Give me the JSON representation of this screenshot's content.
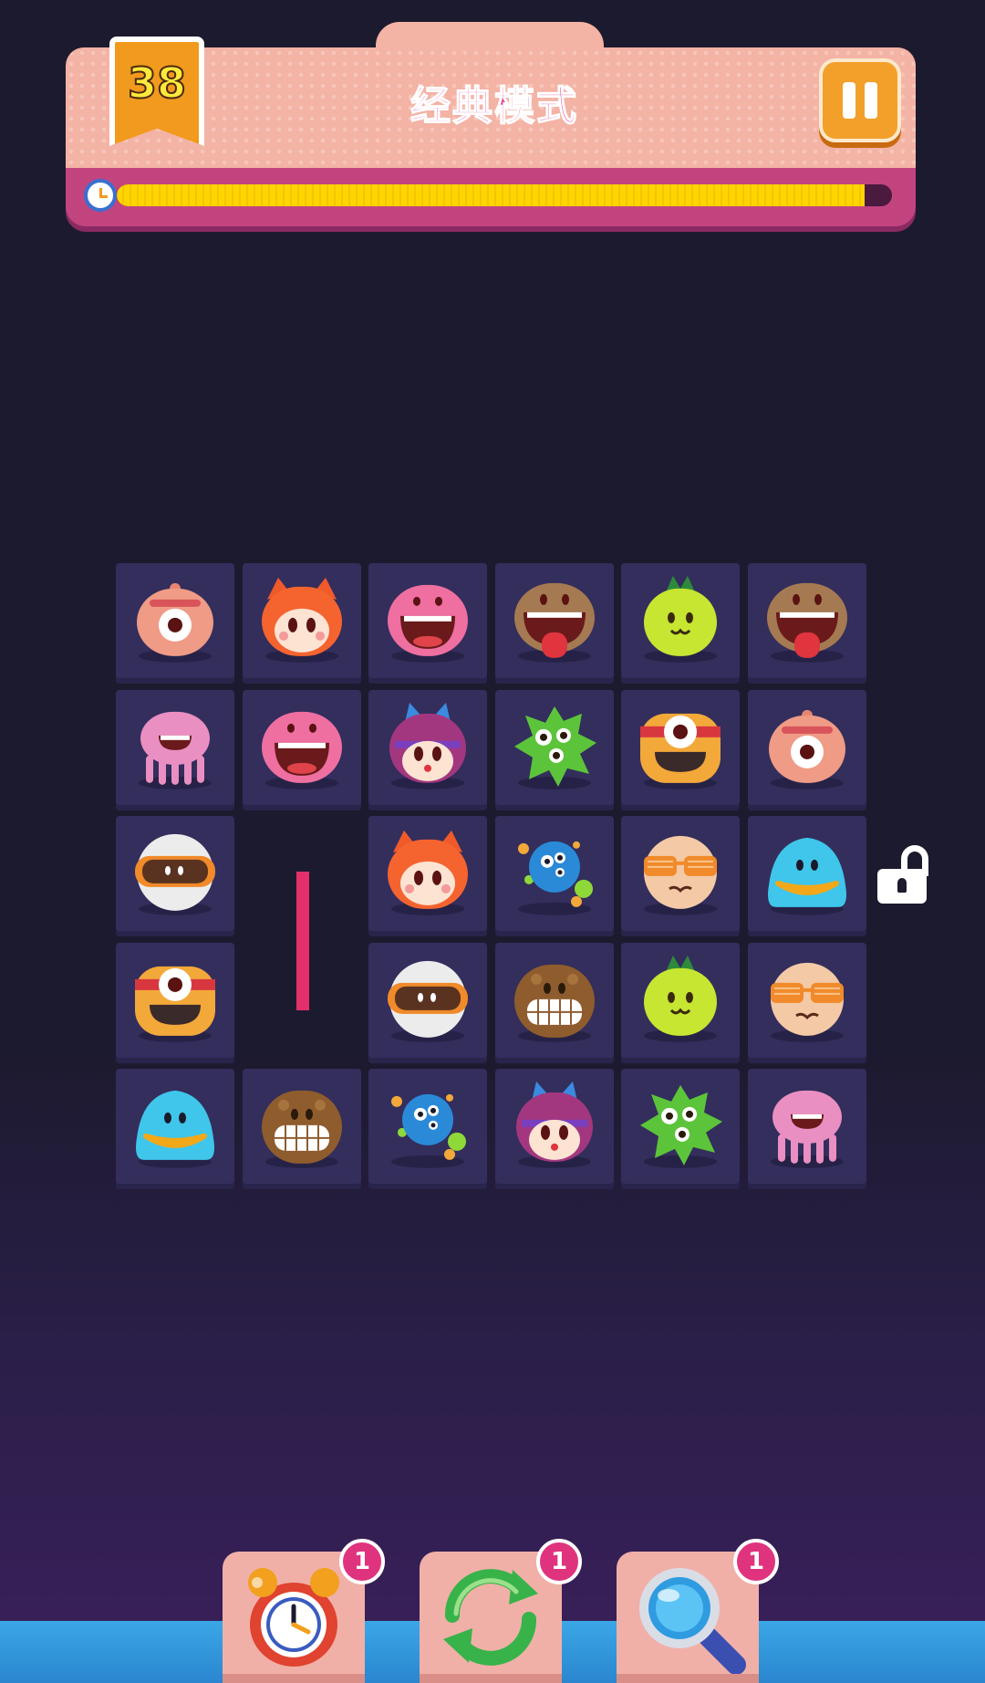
{
  "header": {
    "level": "38",
    "mode_title": "经典模式"
  },
  "timer": {
    "progress": 0.965,
    "icon": "clock-icon"
  },
  "board": {
    "columns": 6,
    "rows": 5,
    "tiles": [
      [
        "pink-cyclops",
        "orange-fox",
        "pink-screamer",
        "brown-tongue",
        "lime-sprout",
        "brown-tongue"
      ],
      [
        "pink-jellyfish",
        "pink-screamer",
        "purple-hood",
        "green-splat",
        "orange-cyclops",
        "pink-cyclops"
      ],
      [
        "helmet-visor",
        "",
        "orange-fox",
        "blue-bubbles",
        "peach-shades",
        "cyan-smile"
      ],
      [
        "orange-cyclops",
        "",
        "helmet-visor",
        "brown-grin",
        "lime-sprout",
        "peach-shades"
      ],
      [
        "cyan-smile",
        "brown-grin",
        "blue-bubbles",
        "purple-hood",
        "green-splat",
        "pink-jellyfish"
      ]
    ]
  },
  "side": {
    "lock_icon": "unlocked-icon"
  },
  "powerups": [
    {
      "name": "time",
      "icon": "alarm-clock-icon",
      "count": "1"
    },
    {
      "name": "shuffle",
      "icon": "shuffle-icon",
      "count": "1"
    },
    {
      "name": "hint",
      "icon": "magnifier-icon",
      "count": "1"
    }
  ],
  "colors": {
    "background": "#1c1a2e",
    "tile": "#332e5c",
    "panel": "#f3b3a5",
    "accent": "#e04a9c",
    "progress": "#ffd500"
  }
}
